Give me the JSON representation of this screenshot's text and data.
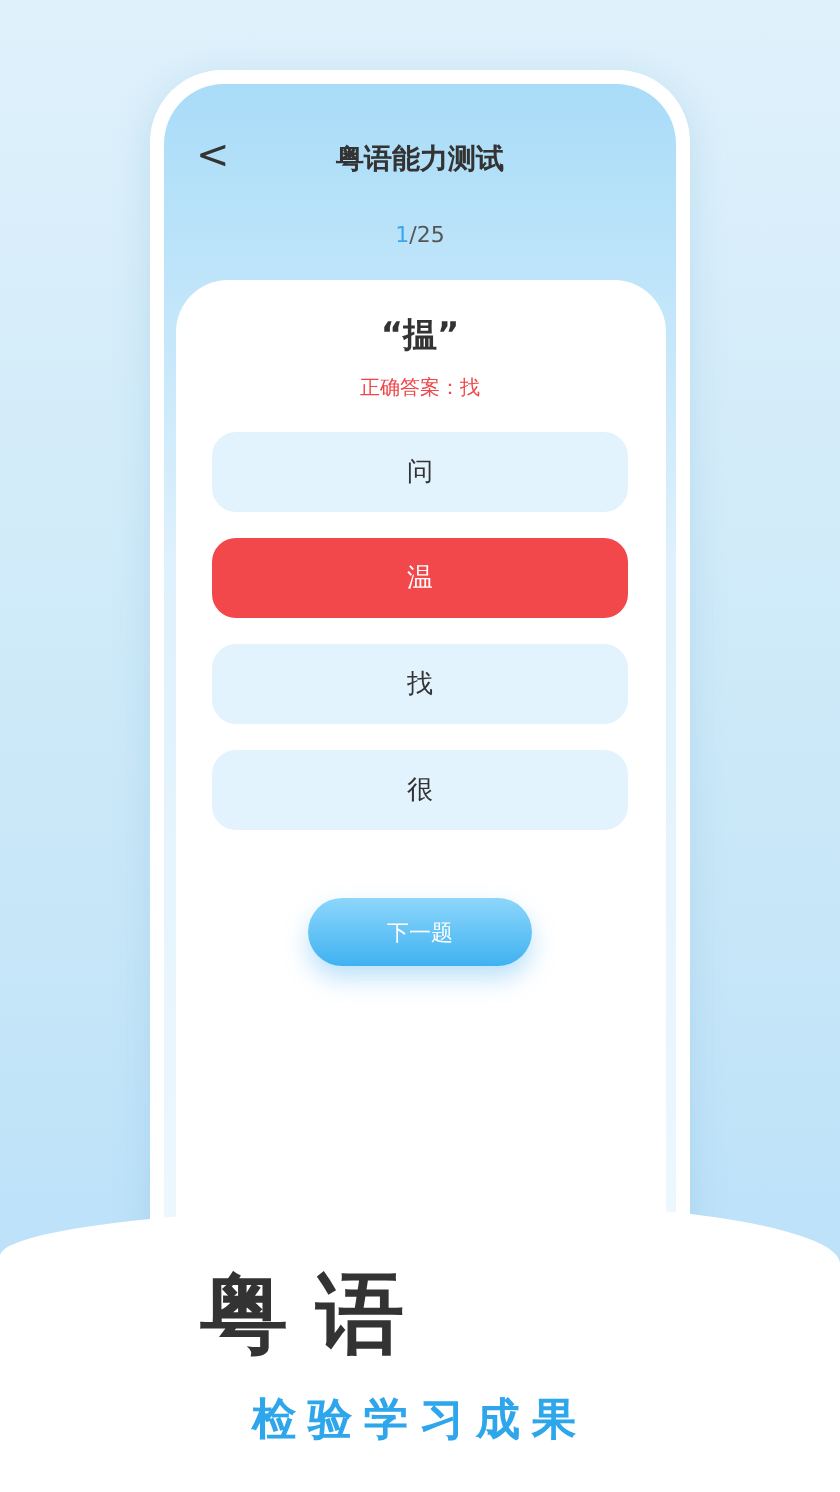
{
  "header": {
    "back": "<",
    "title": "粤语能力测试"
  },
  "progress": {
    "current": "1",
    "total": "/25"
  },
  "question": {
    "word": "“揾”",
    "answer": "正确答案：找"
  },
  "options": [
    {
      "label": "问",
      "selected": false
    },
    {
      "label": "温",
      "selected": true
    },
    {
      "label": "找",
      "selected": false
    },
    {
      "label": "很",
      "selected": false
    }
  ],
  "next_button": "下一题",
  "banner": {
    "headline": "粤语",
    "subtitle": "检验学习成果"
  }
}
